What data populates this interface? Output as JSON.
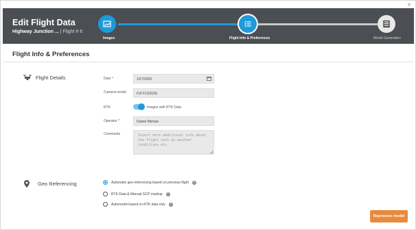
{
  "window": {
    "close_glyph": "×"
  },
  "header": {
    "title": "Edit Flight Data",
    "project": "Highway Junction ...",
    "separator": "|",
    "flight_number": "Flight # 6",
    "background": "#4b4e53",
    "accent": "#1e9bd7"
  },
  "steps": [
    {
      "label": "Images",
      "icon": "image-icon",
      "state": "done"
    },
    {
      "label": "Flight Info & Preferences",
      "icon": "list-icon",
      "state": "active"
    },
    {
      "label": "Model Generation",
      "icon": "layers-icon",
      "state": "pending"
    }
  ],
  "page": {
    "title": "Flight Info & Preferences"
  },
  "flight_details": {
    "heading": "Flight Details",
    "icon": "drone-icon",
    "date_label": "Date *",
    "date_value": "1/27/2020",
    "camera_label": "Camera model",
    "camera_value": "DJI FC6310S",
    "rtk_label": "RTK",
    "rtk_toggle_label": "Images with RTK Data",
    "rtk_enabled": true,
    "operator_label": "Operator *",
    "operator_value": "Daniel Mirman",
    "comments_label": "Comments",
    "comments_placeholder": "Insert here additional info about the flight such as weather conditions etc."
  },
  "geo_referencing": {
    "heading": "Geo Referencing",
    "icon": "location-pin-icon",
    "options": [
      {
        "label": "Automatic geo-referencing based on previous flight",
        "selected": true
      },
      {
        "label": "RTK Data & Manual GCP markup",
        "selected": false
      },
      {
        "label": "Automodel based on RTK data only",
        "selected": false
      }
    ]
  },
  "actions": {
    "reprocess_label": "Reprocess model",
    "color": "#e88a3c"
  }
}
